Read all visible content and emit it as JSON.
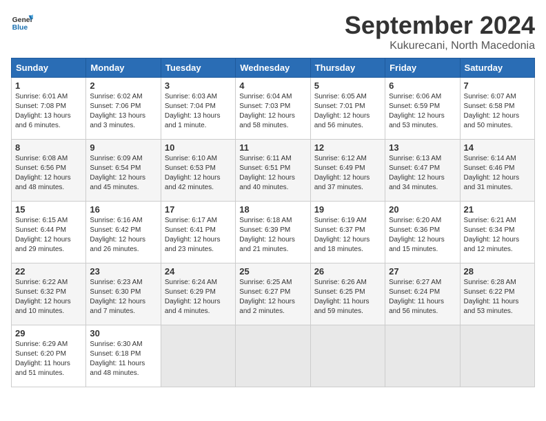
{
  "logo": {
    "general": "General",
    "blue": "Blue"
  },
  "title": "September 2024",
  "location": "Kukurecani, North Macedonia",
  "weekdays": [
    "Sunday",
    "Monday",
    "Tuesday",
    "Wednesday",
    "Thursday",
    "Friday",
    "Saturday"
  ],
  "weeks": [
    [
      {
        "day": 1,
        "sunrise": "6:01 AM",
        "sunset": "7:08 PM",
        "daylight": "13 hours and 6 minutes."
      },
      {
        "day": 2,
        "sunrise": "6:02 AM",
        "sunset": "7:06 PM",
        "daylight": "13 hours and 3 minutes."
      },
      {
        "day": 3,
        "sunrise": "6:03 AM",
        "sunset": "7:04 PM",
        "daylight": "13 hours and 1 minute."
      },
      {
        "day": 4,
        "sunrise": "6:04 AM",
        "sunset": "7:03 PM",
        "daylight": "12 hours and 58 minutes."
      },
      {
        "day": 5,
        "sunrise": "6:05 AM",
        "sunset": "7:01 PM",
        "daylight": "12 hours and 56 minutes."
      },
      {
        "day": 6,
        "sunrise": "6:06 AM",
        "sunset": "6:59 PM",
        "daylight": "12 hours and 53 minutes."
      },
      {
        "day": 7,
        "sunrise": "6:07 AM",
        "sunset": "6:58 PM",
        "daylight": "12 hours and 50 minutes."
      }
    ],
    [
      {
        "day": 8,
        "sunrise": "6:08 AM",
        "sunset": "6:56 PM",
        "daylight": "12 hours and 48 minutes."
      },
      {
        "day": 9,
        "sunrise": "6:09 AM",
        "sunset": "6:54 PM",
        "daylight": "12 hours and 45 minutes."
      },
      {
        "day": 10,
        "sunrise": "6:10 AM",
        "sunset": "6:53 PM",
        "daylight": "12 hours and 42 minutes."
      },
      {
        "day": 11,
        "sunrise": "6:11 AM",
        "sunset": "6:51 PM",
        "daylight": "12 hours and 40 minutes."
      },
      {
        "day": 12,
        "sunrise": "6:12 AM",
        "sunset": "6:49 PM",
        "daylight": "12 hours and 37 minutes."
      },
      {
        "day": 13,
        "sunrise": "6:13 AM",
        "sunset": "6:47 PM",
        "daylight": "12 hours and 34 minutes."
      },
      {
        "day": 14,
        "sunrise": "6:14 AM",
        "sunset": "6:46 PM",
        "daylight": "12 hours and 31 minutes."
      }
    ],
    [
      {
        "day": 15,
        "sunrise": "6:15 AM",
        "sunset": "6:44 PM",
        "daylight": "12 hours and 29 minutes."
      },
      {
        "day": 16,
        "sunrise": "6:16 AM",
        "sunset": "6:42 PM",
        "daylight": "12 hours and 26 minutes."
      },
      {
        "day": 17,
        "sunrise": "6:17 AM",
        "sunset": "6:41 PM",
        "daylight": "12 hours and 23 minutes."
      },
      {
        "day": 18,
        "sunrise": "6:18 AM",
        "sunset": "6:39 PM",
        "daylight": "12 hours and 21 minutes."
      },
      {
        "day": 19,
        "sunrise": "6:19 AM",
        "sunset": "6:37 PM",
        "daylight": "12 hours and 18 minutes."
      },
      {
        "day": 20,
        "sunrise": "6:20 AM",
        "sunset": "6:36 PM",
        "daylight": "12 hours and 15 minutes."
      },
      {
        "day": 21,
        "sunrise": "6:21 AM",
        "sunset": "6:34 PM",
        "daylight": "12 hours and 12 minutes."
      }
    ],
    [
      {
        "day": 22,
        "sunrise": "6:22 AM",
        "sunset": "6:32 PM",
        "daylight": "12 hours and 10 minutes."
      },
      {
        "day": 23,
        "sunrise": "6:23 AM",
        "sunset": "6:30 PM",
        "daylight": "12 hours and 7 minutes."
      },
      {
        "day": 24,
        "sunrise": "6:24 AM",
        "sunset": "6:29 PM",
        "daylight": "12 hours and 4 minutes."
      },
      {
        "day": 25,
        "sunrise": "6:25 AM",
        "sunset": "6:27 PM",
        "daylight": "12 hours and 2 minutes."
      },
      {
        "day": 26,
        "sunrise": "6:26 AM",
        "sunset": "6:25 PM",
        "daylight": "11 hours and 59 minutes."
      },
      {
        "day": 27,
        "sunrise": "6:27 AM",
        "sunset": "6:24 PM",
        "daylight": "11 hours and 56 minutes."
      },
      {
        "day": 28,
        "sunrise": "6:28 AM",
        "sunset": "6:22 PM",
        "daylight": "11 hours and 53 minutes."
      }
    ],
    [
      {
        "day": 29,
        "sunrise": "6:29 AM",
        "sunset": "6:20 PM",
        "daylight": "11 hours and 51 minutes."
      },
      {
        "day": 30,
        "sunrise": "6:30 AM",
        "sunset": "6:18 PM",
        "daylight": "11 hours and 48 minutes."
      },
      null,
      null,
      null,
      null,
      null
    ]
  ]
}
